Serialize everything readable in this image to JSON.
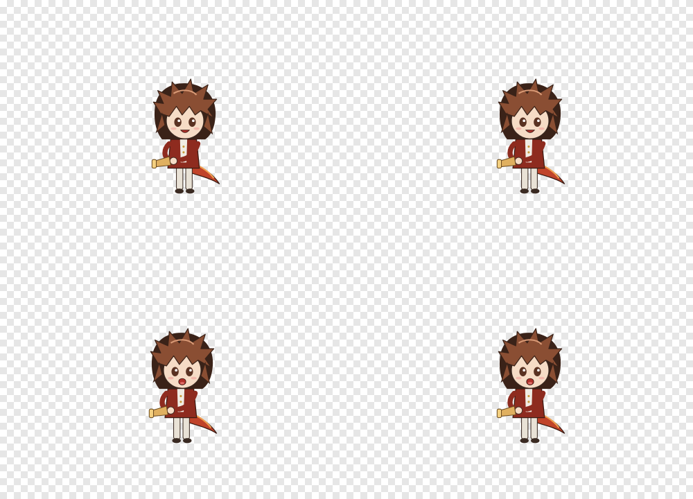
{
  "canvas": {
    "background": "transparency-checkerboard",
    "checker_colors": [
      "#ffffff",
      "#e6e6e6"
    ]
  },
  "sprites": [
    {
      "id": "frame-1",
      "character": "chibi-swordsman",
      "pose": "idle-grin",
      "flip": false
    },
    {
      "id": "frame-2",
      "character": "chibi-swordsman",
      "pose": "idle-grin",
      "flip": false
    },
    {
      "id": "frame-3",
      "character": "chibi-swordsman",
      "pose": "idle-open-mouth",
      "flip": false
    },
    {
      "id": "frame-4",
      "character": "chibi-swordsman",
      "pose": "idle-open-mouth",
      "flip": false
    }
  ],
  "palette": {
    "hair": "#8a4e33",
    "hair_dark": "#3a2218",
    "coat": "#8e2b1f",
    "coat_tail": "#c0432a",
    "skin": "#f6dcc6",
    "trousers": "#e9e2d6",
    "hilt": "#e0b060"
  }
}
